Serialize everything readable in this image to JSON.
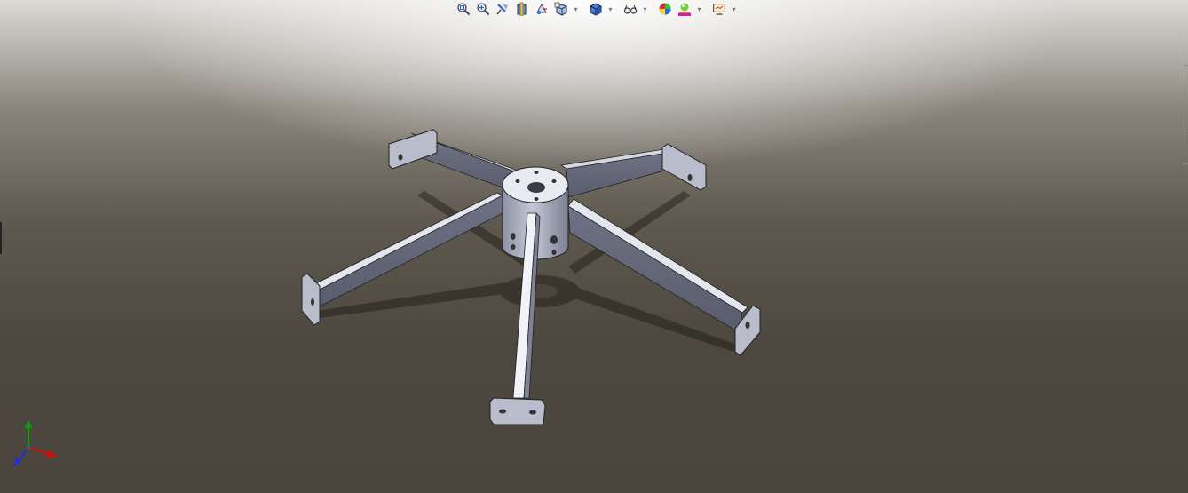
{
  "viewport": {
    "background_top": "#dcdad6",
    "background_bottom": "#4a463e",
    "part_color": "#9ea3b4"
  },
  "heads_up_toolbar": {
    "buttons": [
      {
        "name": "zoom-to-fit-icon",
        "icon": "magnifier-fit"
      },
      {
        "name": "zoom-to-area-icon",
        "icon": "magnifier-area"
      },
      {
        "name": "previous-view-icon",
        "icon": "arrow-back"
      },
      {
        "name": "section-view-icon",
        "icon": "section-cube"
      },
      {
        "name": "dynamic-annotation-views-icon",
        "icon": "annotation"
      },
      {
        "name": "view-orientation-icon",
        "icon": "cube-views"
      },
      {
        "name": "display-style-icon",
        "icon": "shaded-cube"
      },
      {
        "name": "hide-show-items-icon",
        "icon": "glasses"
      },
      {
        "name": "edit-appearance-icon",
        "icon": "color-ball"
      },
      {
        "name": "apply-scene-icon",
        "icon": "scene-ball"
      },
      {
        "name": "view-settings-icon",
        "icon": "monitor"
      }
    ]
  },
  "triad": {
    "x_color": "#d01010",
    "y_color": "#10a010",
    "z_color": "#2030d0"
  }
}
